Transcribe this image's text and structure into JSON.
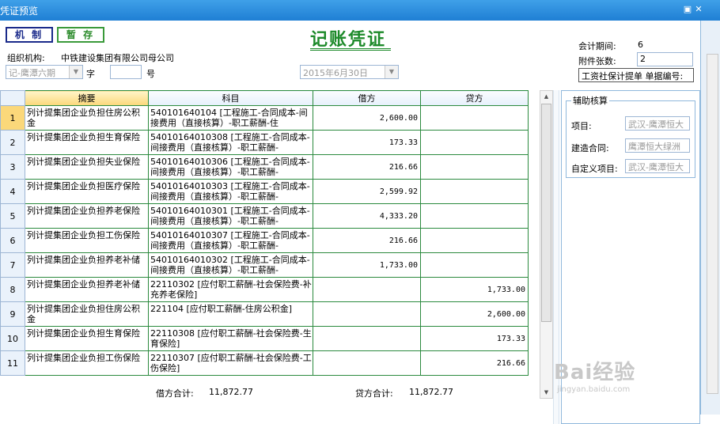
{
  "window": {
    "title": "凭证预览",
    "restore_icon": "window-restore-icon",
    "close_icon": "close-icon"
  },
  "toolbar": {
    "jizhi_label": "机 制",
    "zancun_label": "暂 存"
  },
  "voucher": {
    "title": "记账凭证",
    "org_label": "组织机构:",
    "org_value": "中铁建设集团有限公司母公司",
    "voucher_type": "记-鹰潭六期",
    "zi_label": "字",
    "number_value": "",
    "hao_label": "号",
    "date_value": "2015年6月30日",
    "period_label": "会计期间:",
    "period_value": "6",
    "attach_label": "附件张数:",
    "attach_value": "2",
    "doc_label": "工资社保计提单 单据编号:"
  },
  "grid": {
    "headers": {
      "summary": "摘要",
      "account": "科目",
      "debit": "借方",
      "credit": "贷方"
    },
    "rows": [
      {
        "no": "1",
        "summary": "列计提集团企业负担住房公积金",
        "account": "540101640104 [工程施工-合同成本-间接费用（直接核算）-职工薪酬-住",
        "debit": "2,600.00",
        "credit": ""
      },
      {
        "no": "2",
        "summary": "列计提集团企业负担生育保险",
        "account": "54010164010308 [工程施工-合同成本-间接费用（直接核算）-职工薪酬-",
        "debit": "173.33",
        "credit": ""
      },
      {
        "no": "3",
        "summary": "列计提集团企业负担失业保险",
        "account": "54010164010306 [工程施工-合同成本-间接费用（直接核算）-职工薪酬-",
        "debit": "216.66",
        "credit": ""
      },
      {
        "no": "4",
        "summary": "列计提集团企业负担医疗保险",
        "account": "54010164010303 [工程施工-合同成本-间接费用（直接核算）-职工薪酬-",
        "debit": "2,599.92",
        "credit": ""
      },
      {
        "no": "5",
        "summary": "列计提集团企业负担养老保险",
        "account": "54010164010301 [工程施工-合同成本-间接费用（直接核算）-职工薪酬-",
        "debit": "4,333.20",
        "credit": ""
      },
      {
        "no": "6",
        "summary": "列计提集团企业负担工伤保险",
        "account": "54010164010307 [工程施工-合同成本-间接费用（直接核算）-职工薪酬-",
        "debit": "216.66",
        "credit": ""
      },
      {
        "no": "7",
        "summary": "列计提集团企业负担养老补储",
        "account": "54010164010302 [工程施工-合同成本-间接费用（直接核算）-职工薪酬-",
        "debit": "1,733.00",
        "credit": ""
      },
      {
        "no": "8",
        "summary": "列计提集团企业负担养老补储",
        "account": "22110302 [应付职工薪酬-社会保险费-补充养老保险]",
        "debit": "",
        "credit": "1,733.00"
      },
      {
        "no": "9",
        "summary": "列计提集团企业负担住房公积金",
        "account": "221104 [应付职工薪酬-住房公积金]",
        "debit": "",
        "credit": "2,600.00"
      },
      {
        "no": "10",
        "summary": "列计提集团企业负担生育保险",
        "account": "22110308 [应付职工薪酬-社会保险费-生育保险]",
        "debit": "",
        "credit": "173.33"
      },
      {
        "no": "11",
        "summary": "列计提集团企业负担工伤保险",
        "account": "22110307 [应付职工薪酬-社会保险费-工伤保险]",
        "debit": "",
        "credit": "216.66"
      }
    ],
    "debit_total_label": "借方合计:",
    "debit_total": "11,872.77",
    "credit_total_label": "贷方合计:",
    "credit_total": "11,872.77"
  },
  "aux": {
    "legend": "辅助核算",
    "project_label": "项目:",
    "project_value": "武汉-鹰潭恒大",
    "contract_label": "建造合同:",
    "contract_value": "鹰潭恒大绿洲",
    "custom_label": "自定义项目:",
    "custom_value": "武汉-鹰潭恒大"
  },
  "watermark": {
    "brand": "Bai经验",
    "url": "jingyan.baidu.com"
  }
}
